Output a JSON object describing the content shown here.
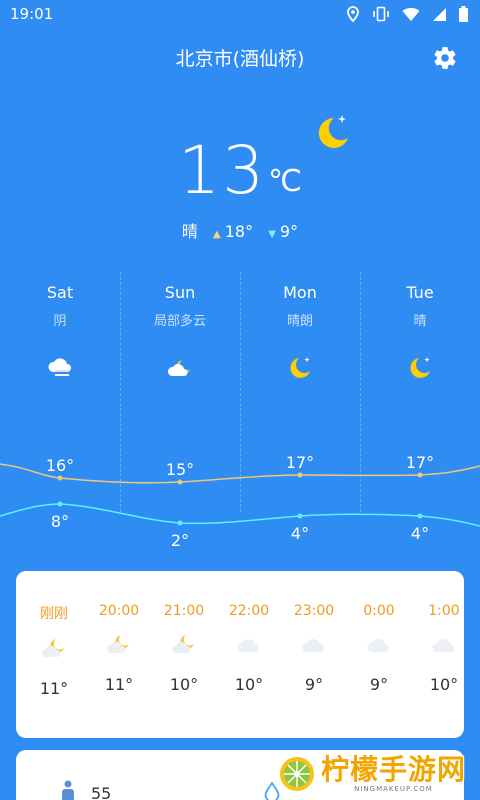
{
  "status": {
    "time": "19:01"
  },
  "header": {
    "city": "北京市(酒仙桥)"
  },
  "current": {
    "temp": "13",
    "unit": "℃",
    "condition": "晴",
    "high": "18°",
    "low": "9°",
    "icon": "moon-stars-icon"
  },
  "forecast": [
    {
      "day": "Sat",
      "cond": "阴",
      "icon": "cloud-fog-icon",
      "high": "16°",
      "low": "8°"
    },
    {
      "day": "Sun",
      "cond": "局部多云",
      "icon": "partly-cloudy-night-icon",
      "high": "15°",
      "low": "2°"
    },
    {
      "day": "Mon",
      "cond": "晴朗",
      "icon": "moon-stars-icon",
      "high": "17°",
      "low": "4°"
    },
    {
      "day": "Tue",
      "cond": "晴",
      "icon": "moon-stars-icon",
      "high": "17°",
      "low": "4°"
    }
  ],
  "hourly": [
    {
      "time": "刚刚",
      "icon": "partly-cloudy-night-icon",
      "temp": "11°"
    },
    {
      "time": "20:00",
      "icon": "partly-cloudy-night-icon",
      "temp": "11°"
    },
    {
      "time": "21:00",
      "icon": "partly-cloudy-night-icon",
      "temp": "10°"
    },
    {
      "time": "22:00",
      "icon": "cloud-icon",
      "temp": "10°"
    },
    {
      "time": "23:00",
      "icon": "cloud-icon",
      "temp": "9°"
    },
    {
      "time": "0:00",
      "icon": "cloud-icon",
      "temp": "9°"
    },
    {
      "time": "1:00",
      "icon": "cloud-icon",
      "temp": "10°"
    }
  ],
  "details": {
    "aqi": "55"
  },
  "watermark": {
    "text": "柠檬手游网",
    "sub": "NINGMAKEUP.COM"
  },
  "colors": {
    "background": "#2f8cf2",
    "hour_time": "#f39a1e",
    "high_curve": "#f0c77a",
    "low_curve": "#5ff0ff",
    "moon": "#ffd000"
  }
}
